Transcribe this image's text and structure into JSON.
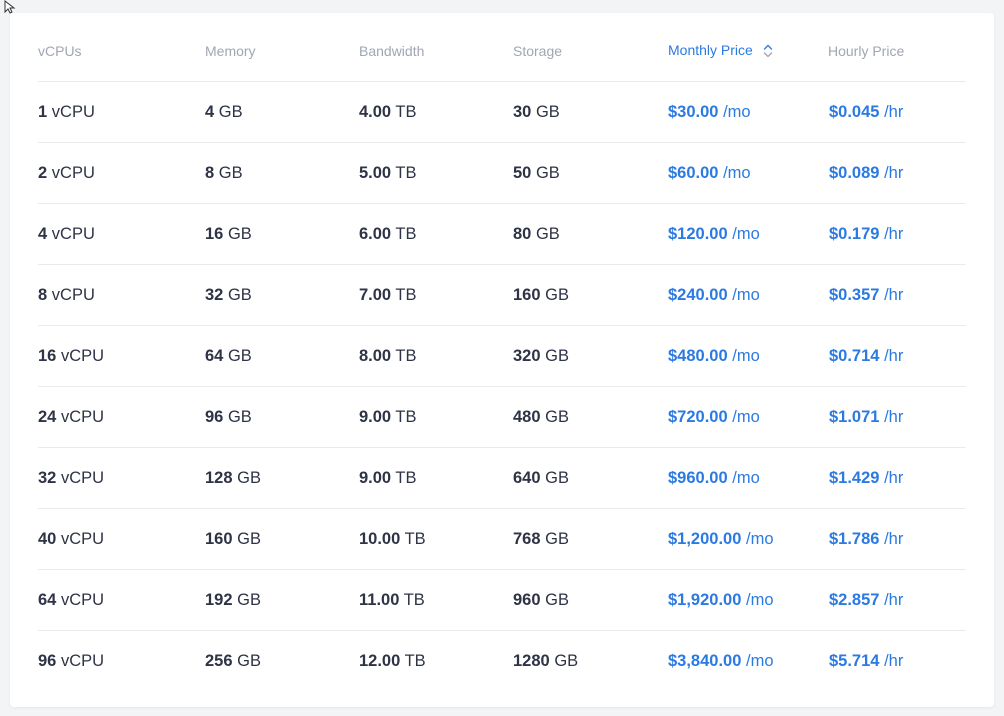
{
  "columns": {
    "vcpus": "vCPUs",
    "memory": "Memory",
    "bandwidth": "Bandwidth",
    "storage": "Storage",
    "monthly": "Monthly Price",
    "hourly": "Hourly Price"
  },
  "sort_icon": "sort-toggle-icon",
  "accent_color": "#2a7ae2",
  "rows": [
    {
      "vcpu": "1",
      "vcpu_unit": "vCPU",
      "mem": "4",
      "mem_unit": "GB",
      "bw": "4.00",
      "bw_unit": "TB",
      "sto": "30",
      "sto_unit": "GB",
      "monthly": "$30.00",
      "monthly_unit": "/mo",
      "hourly": "$0.045",
      "hourly_unit": "/hr"
    },
    {
      "vcpu": "2",
      "vcpu_unit": "vCPU",
      "mem": "8",
      "mem_unit": "GB",
      "bw": "5.00",
      "bw_unit": "TB",
      "sto": "50",
      "sto_unit": "GB",
      "monthly": "$60.00",
      "monthly_unit": "/mo",
      "hourly": "$0.089",
      "hourly_unit": "/hr"
    },
    {
      "vcpu": "4",
      "vcpu_unit": "vCPU",
      "mem": "16",
      "mem_unit": "GB",
      "bw": "6.00",
      "bw_unit": "TB",
      "sto": "80",
      "sto_unit": "GB",
      "monthly": "$120.00",
      "monthly_unit": "/mo",
      "hourly": "$0.179",
      "hourly_unit": "/hr"
    },
    {
      "vcpu": "8",
      "vcpu_unit": "vCPU",
      "mem": "32",
      "mem_unit": "GB",
      "bw": "7.00",
      "bw_unit": "TB",
      "sto": "160",
      "sto_unit": "GB",
      "monthly": "$240.00",
      "monthly_unit": "/mo",
      "hourly": "$0.357",
      "hourly_unit": "/hr"
    },
    {
      "vcpu": "16",
      "vcpu_unit": "vCPU",
      "mem": "64",
      "mem_unit": "GB",
      "bw": "8.00",
      "bw_unit": "TB",
      "sto": "320",
      "sto_unit": "GB",
      "monthly": "$480.00",
      "monthly_unit": "/mo",
      "hourly": "$0.714",
      "hourly_unit": "/hr"
    },
    {
      "vcpu": "24",
      "vcpu_unit": "vCPU",
      "mem": "96",
      "mem_unit": "GB",
      "bw": "9.00",
      "bw_unit": "TB",
      "sto": "480",
      "sto_unit": "GB",
      "monthly": "$720.00",
      "monthly_unit": "/mo",
      "hourly": "$1.071",
      "hourly_unit": "/hr"
    },
    {
      "vcpu": "32",
      "vcpu_unit": "vCPU",
      "mem": "128",
      "mem_unit": "GB",
      "bw": "9.00",
      "bw_unit": "TB",
      "sto": "640",
      "sto_unit": "GB",
      "monthly": "$960.00",
      "monthly_unit": "/mo",
      "hourly": "$1.429",
      "hourly_unit": "/hr"
    },
    {
      "vcpu": "40",
      "vcpu_unit": "vCPU",
      "mem": "160",
      "mem_unit": "GB",
      "bw": "10.00",
      "bw_unit": "TB",
      "sto": "768",
      "sto_unit": "GB",
      "monthly": "$1,200.00",
      "monthly_unit": "/mo",
      "hourly": "$1.786",
      "hourly_unit": "/hr"
    },
    {
      "vcpu": "64",
      "vcpu_unit": "vCPU",
      "mem": "192",
      "mem_unit": "GB",
      "bw": "11.00",
      "bw_unit": "TB",
      "sto": "960",
      "sto_unit": "GB",
      "monthly": "$1,920.00",
      "monthly_unit": "/mo",
      "hourly": "$2.857",
      "hourly_unit": "/hr"
    },
    {
      "vcpu": "96",
      "vcpu_unit": "vCPU",
      "mem": "256",
      "mem_unit": "GB",
      "bw": "12.00",
      "bw_unit": "TB",
      "sto": "1280",
      "sto_unit": "GB",
      "monthly": "$3,840.00",
      "monthly_unit": "/mo",
      "hourly": "$5.714",
      "hourly_unit": "/hr"
    }
  ]
}
